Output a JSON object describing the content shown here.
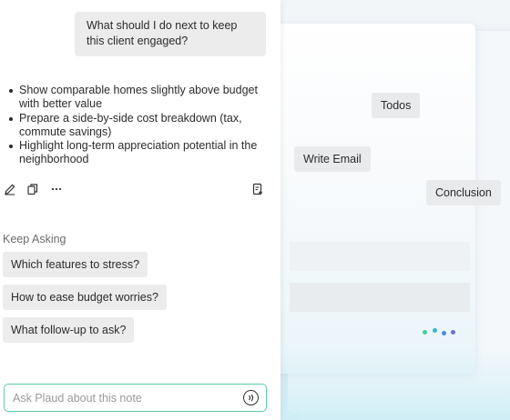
{
  "conversation": {
    "user_message": "What should I do next to keep this client engaged?",
    "answer_bullets": [
      "Show comparable homes slightly above budget with better value",
      "Prepare a side-by-side cost breakdown (tax, commute savings)",
      "Highlight long-term appreciation potential in the neighborhood"
    ]
  },
  "actions": {
    "icons": [
      "edit-icon",
      "copy-icon",
      "more-icon",
      "save-note-icon"
    ]
  },
  "keep_asking": {
    "heading": "Keep Asking",
    "suggestions": [
      "Which features to stress?",
      "How to ease budget worries?",
      "What follow-up to ask?"
    ]
  },
  "ask_box": {
    "placeholder": "Ask Plaud about this note",
    "value": ""
  },
  "floating_chips": {
    "todos": "Todos",
    "write_email": "Write Email",
    "conclusion": "Conclusion"
  },
  "colors": {
    "accent": "#5ecba1",
    "dot_1": "#3ccf9b",
    "dot_2": "#3ab8c8",
    "dot_3": "#4d8fd6",
    "dot_4": "#6f6fd8"
  }
}
